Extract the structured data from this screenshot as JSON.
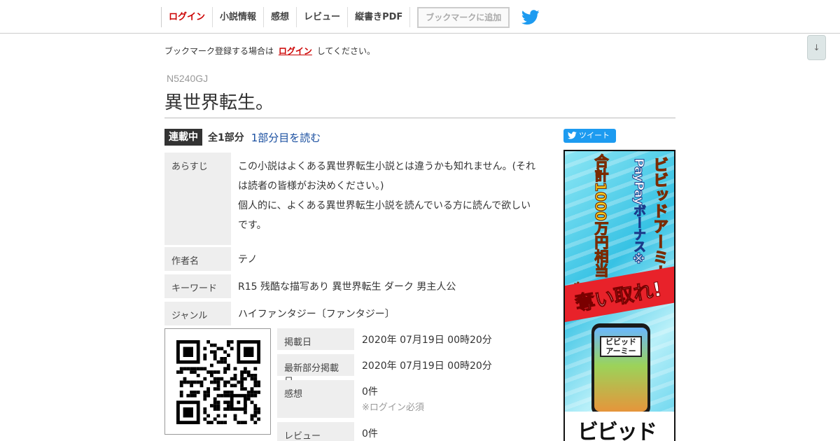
{
  "nav": {
    "items": [
      "ログイン",
      "小説情報",
      "感想",
      "レビュー",
      "縦書きPDF"
    ],
    "bookmark_button": "ブックマークに追加",
    "twitter_icon": "twitter-bird-icon",
    "scroll_button": "↓"
  },
  "notice": {
    "before": "ブックマーク登録する場合は",
    "link": "ログイン",
    "after": "してください。"
  },
  "novel": {
    "ncode": "N5240GJ",
    "title": "異世界転生。",
    "status": "連載中",
    "parts": "全1部分",
    "read_link": "1部分目を読む"
  },
  "info": {
    "synopsis_label": "あらすじ",
    "synopsis_line1": "この小説はよくある異世界転生小説とは違うかも知れません。(それ",
    "synopsis_line2": "は読者の皆様がお決めください。)",
    "synopsis_line3": "個人的に、よくある異世界転生小説を読んでいる方に読んで欲しい",
    "synopsis_line4": "です。",
    "author_label": "作者名",
    "author": "テノ",
    "keyword_label": "キーワード",
    "keywords": "R15 残酷な描写あり 異世界転生  ダーク 男主人公",
    "genre_label": "ジャンル",
    "genre": "ハイファンタジー〔ファンタジー〕"
  },
  "meta": {
    "published_label": "掲載日",
    "published": "2020年 07月19日 00時20分",
    "latest_label": "最新部分掲載日",
    "latest": "2020年 07月19日 00時20分",
    "impressions_label": "感想",
    "impressions": "0件",
    "impressions_note": "※ログイン必須",
    "reviews_label": "レビュー",
    "reviews": "0件"
  },
  "sidebar": {
    "tweet_button": "ツイート",
    "ad": {
      "line1": "ビビッドアーミー",
      "line2": "PayPayボーナス※",
      "line3": "合計1000万円相当",
      "line4": "を",
      "banner": "奪い取れ!",
      "phone_logo": "ビビッド アーミー",
      "bottom": "ビビッド"
    }
  },
  "colors": {
    "accent_red": "#cc0000",
    "link_blue": "#1a4fa0",
    "twitter_blue": "#1d9bf0"
  }
}
